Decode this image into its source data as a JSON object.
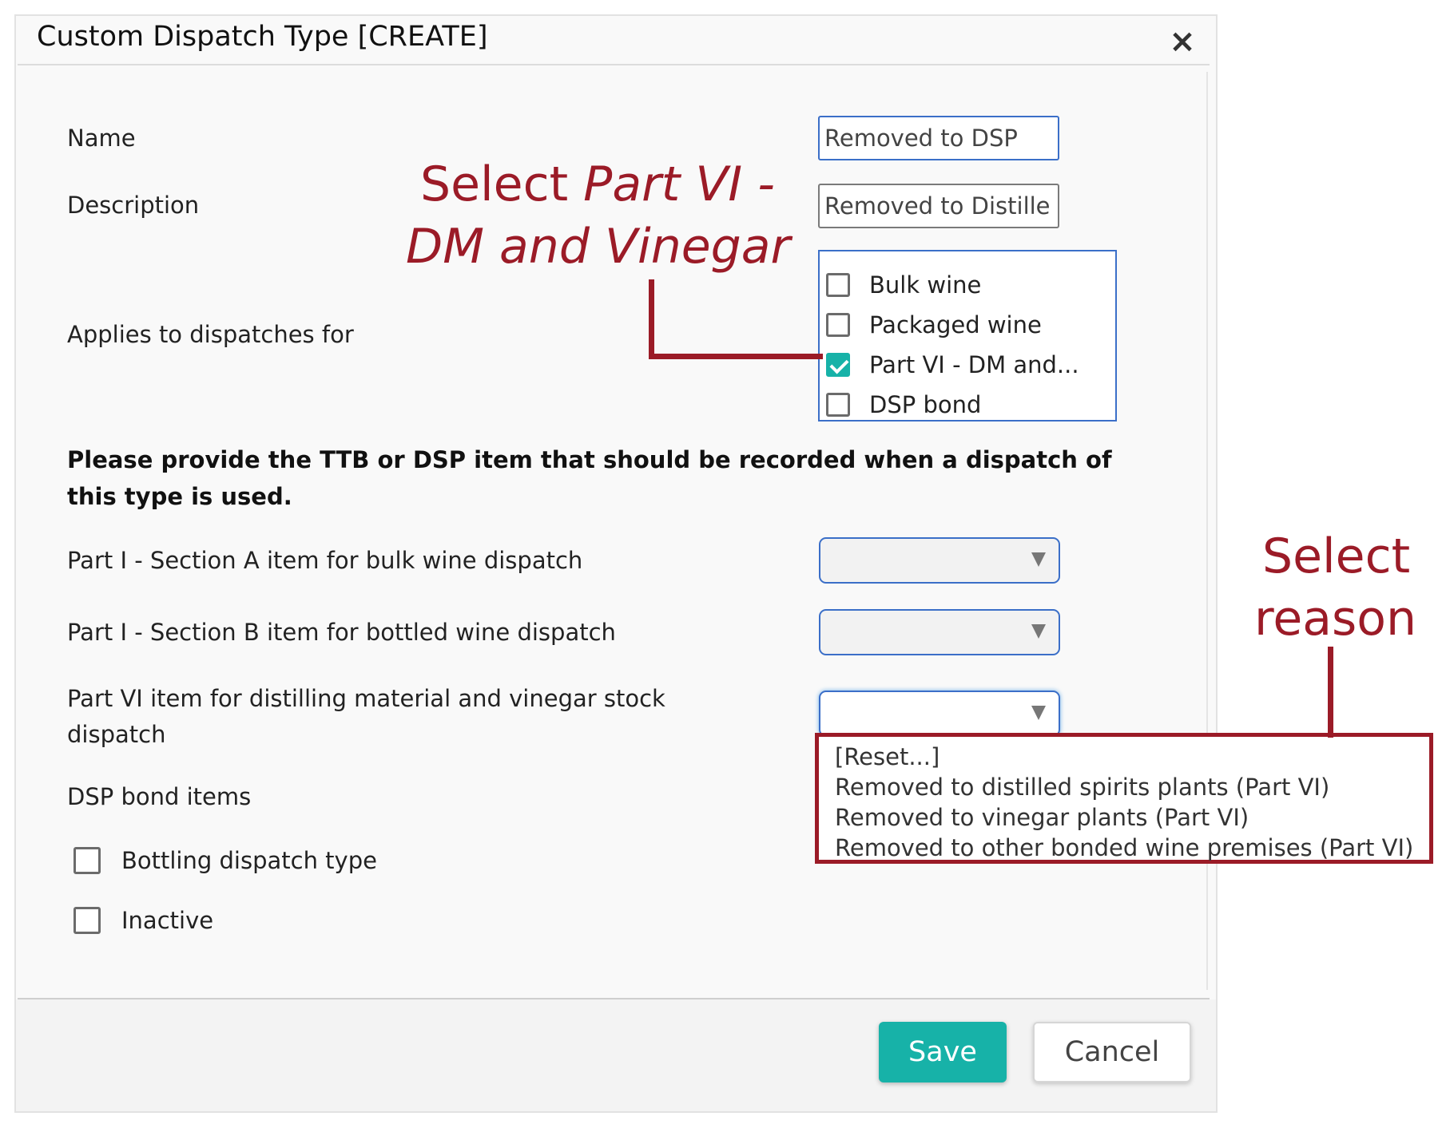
{
  "dialog": {
    "title": "Custom Dispatch Type [CREATE]",
    "close_icon": "×"
  },
  "form": {
    "name_label": "Name",
    "name_value": "Removed to DSP",
    "description_label": "Description",
    "description_value": "Removed to Distille",
    "applies_label": "Applies to dispatches for",
    "applies_options": [
      {
        "label": "Bulk wine",
        "checked": false
      },
      {
        "label": "Packaged wine",
        "checked": false
      },
      {
        "label": "Part VI - DM and...",
        "checked": true
      },
      {
        "label": "DSP bond",
        "checked": false
      }
    ],
    "instructions": "Please provide the TTB or DSP item that should be recorded when a dispatch of this type is used.",
    "part1a_label": "Part I - Section A item for bulk wine dispatch",
    "part1b_label": "Part I - Section B item for bottled wine dispatch",
    "part6_label": "Part VI item for distilling material and vinegar stock dispatch",
    "dsp_bond_label": "DSP bond items",
    "bottling_label": "Bottling dispatch type",
    "inactive_label": "Inactive",
    "bottling_checked": false,
    "inactive_checked": false
  },
  "dropdown": {
    "options": [
      "[Reset...]",
      "Removed to distilled spirits plants (Part VI)",
      "Removed to vinegar plants (Part VI)",
      "Removed to other bonded wine premises (Part VI)"
    ]
  },
  "footer": {
    "save_label": "Save",
    "cancel_label": "Cancel"
  },
  "annotations": {
    "select_part_line1_prefix": "Select ",
    "select_part_line1_italic": "Part VI -",
    "select_part_line2": "DM and Vinegar",
    "select_reason_line1": "Select",
    "select_reason_line2": "reason"
  },
  "colors": {
    "accent": "#17b2a8",
    "annotation": "#9b1b27",
    "focus_border": "#3b6fc8"
  }
}
